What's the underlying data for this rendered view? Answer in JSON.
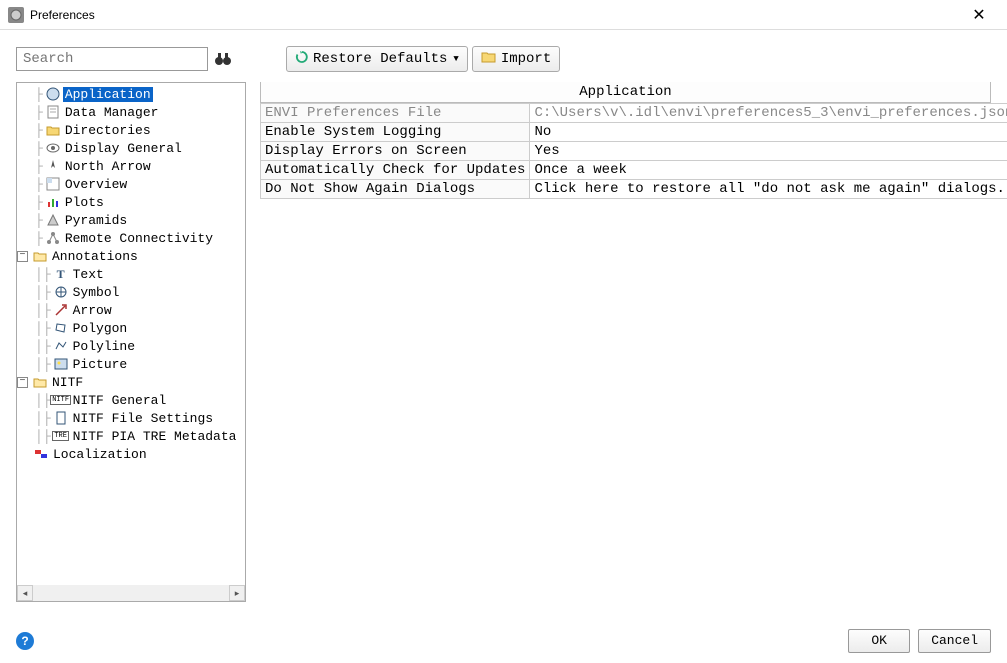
{
  "window": {
    "title": "Preferences"
  },
  "toolbar": {
    "search_placeholder": "Search",
    "restore_label": "Restore Defaults",
    "import_label": "Import"
  },
  "tree": {
    "items": [
      {
        "label": "Application",
        "depth": 1,
        "selected": true,
        "icon": "globe-icon"
      },
      {
        "label": "Data Manager",
        "depth": 1,
        "icon": "sheet-icon"
      },
      {
        "label": "Directories",
        "depth": 1,
        "icon": "folder-icon"
      },
      {
        "label": "Display General",
        "depth": 1,
        "icon": "eye-icon"
      },
      {
        "label": "North Arrow",
        "depth": 1,
        "icon": "compass-icon"
      },
      {
        "label": "Overview",
        "depth": 1,
        "icon": "layout-icon"
      },
      {
        "label": "Plots",
        "depth": 1,
        "icon": "chart-icon"
      },
      {
        "label": "Pyramids",
        "depth": 1,
        "icon": "pyramid-icon"
      },
      {
        "label": "Remote Connectivity",
        "depth": 1,
        "icon": "network-icon"
      },
      {
        "label": "Annotations",
        "depth": 0,
        "expandable": true,
        "expanded": true,
        "icon": "folder-open-icon"
      },
      {
        "label": "Text",
        "depth": 2,
        "icon": "text-icon"
      },
      {
        "label": "Symbol",
        "depth": 2,
        "icon": "symbol-icon"
      },
      {
        "label": "Arrow",
        "depth": 2,
        "icon": "arrow-icon"
      },
      {
        "label": "Polygon",
        "depth": 2,
        "icon": "polygon-icon"
      },
      {
        "label": "Polyline",
        "depth": 2,
        "icon": "polyline-icon"
      },
      {
        "label": "Picture",
        "depth": 2,
        "icon": "picture-icon"
      },
      {
        "label": "NITF",
        "depth": 0,
        "expandable": true,
        "expanded": true,
        "icon": "folder-open-icon"
      },
      {
        "label": "NITF General",
        "depth": 2,
        "icon": "nitf-icon"
      },
      {
        "label": "NITF File Settings",
        "depth": 2,
        "icon": "file-icon"
      },
      {
        "label": "NITF PIA TRE Metadata",
        "depth": 2,
        "icon": "tre-icon"
      },
      {
        "label": "Localization",
        "depth": 0,
        "icon": "locale-icon"
      }
    ]
  },
  "properties": {
    "header": "Application",
    "rows": [
      {
        "key": "ENVI Preferences File",
        "value": "C:\\Users\\v\\.idl\\envi\\preferences5_3\\envi_preferences.json",
        "disabled": true
      },
      {
        "key": "Enable System Logging",
        "value": "No"
      },
      {
        "key": "Display Errors on Screen",
        "value": "Yes"
      },
      {
        "key": "Automatically Check for Updates",
        "value": "Once a week"
      },
      {
        "key": "Do Not Show Again Dialogs",
        "value": "Click here to restore all \"do not ask me again\" dialogs."
      }
    ]
  },
  "footer": {
    "ok": "OK",
    "cancel": "Cancel"
  }
}
